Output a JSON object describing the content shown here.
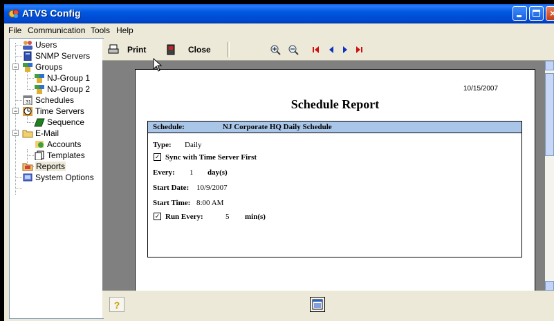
{
  "window": {
    "title": "ATVS Config"
  },
  "menu": [
    "File",
    "Communication",
    "Tools",
    "Help"
  ],
  "tree": {
    "users": "Users",
    "snmp": "SNMP Servers",
    "groups": "Groups",
    "group1": "NJ-Group 1",
    "group2": "NJ-Group 2",
    "schedules": "Schedules",
    "timeservers": "Time Servers",
    "sequence": "Sequence",
    "email": "E-Mail",
    "accounts": "Accounts",
    "templates": "Templates",
    "reports": "Reports",
    "sysopts": "System Options"
  },
  "toolbar": {
    "print": "Print",
    "close": "Close"
  },
  "report": {
    "date": "10/15/2007",
    "title": "Schedule Report",
    "schedule_label": "Schedule:",
    "schedule_value": "NJ Corporate HQ Daily Schedule",
    "type_label": "Type:",
    "type_value": "Daily",
    "sync_label": "Sync with Time Server First",
    "every_label": "Every:",
    "every_value": "1",
    "every_unit": "day(s)",
    "start_date_label": "Start Date:",
    "start_date_value": "10/9/2007",
    "start_time_label": "Start Time:",
    "start_time_value": "8:00 AM",
    "run_every_label": "Run Every:",
    "run_every_value": "5",
    "run_every_unit": "min(s)",
    "check_mark": "☑"
  },
  "bottom": {
    "help": "?"
  },
  "colors": {
    "titlebar": "#0054e3",
    "report_header": "#a9c5e8"
  }
}
